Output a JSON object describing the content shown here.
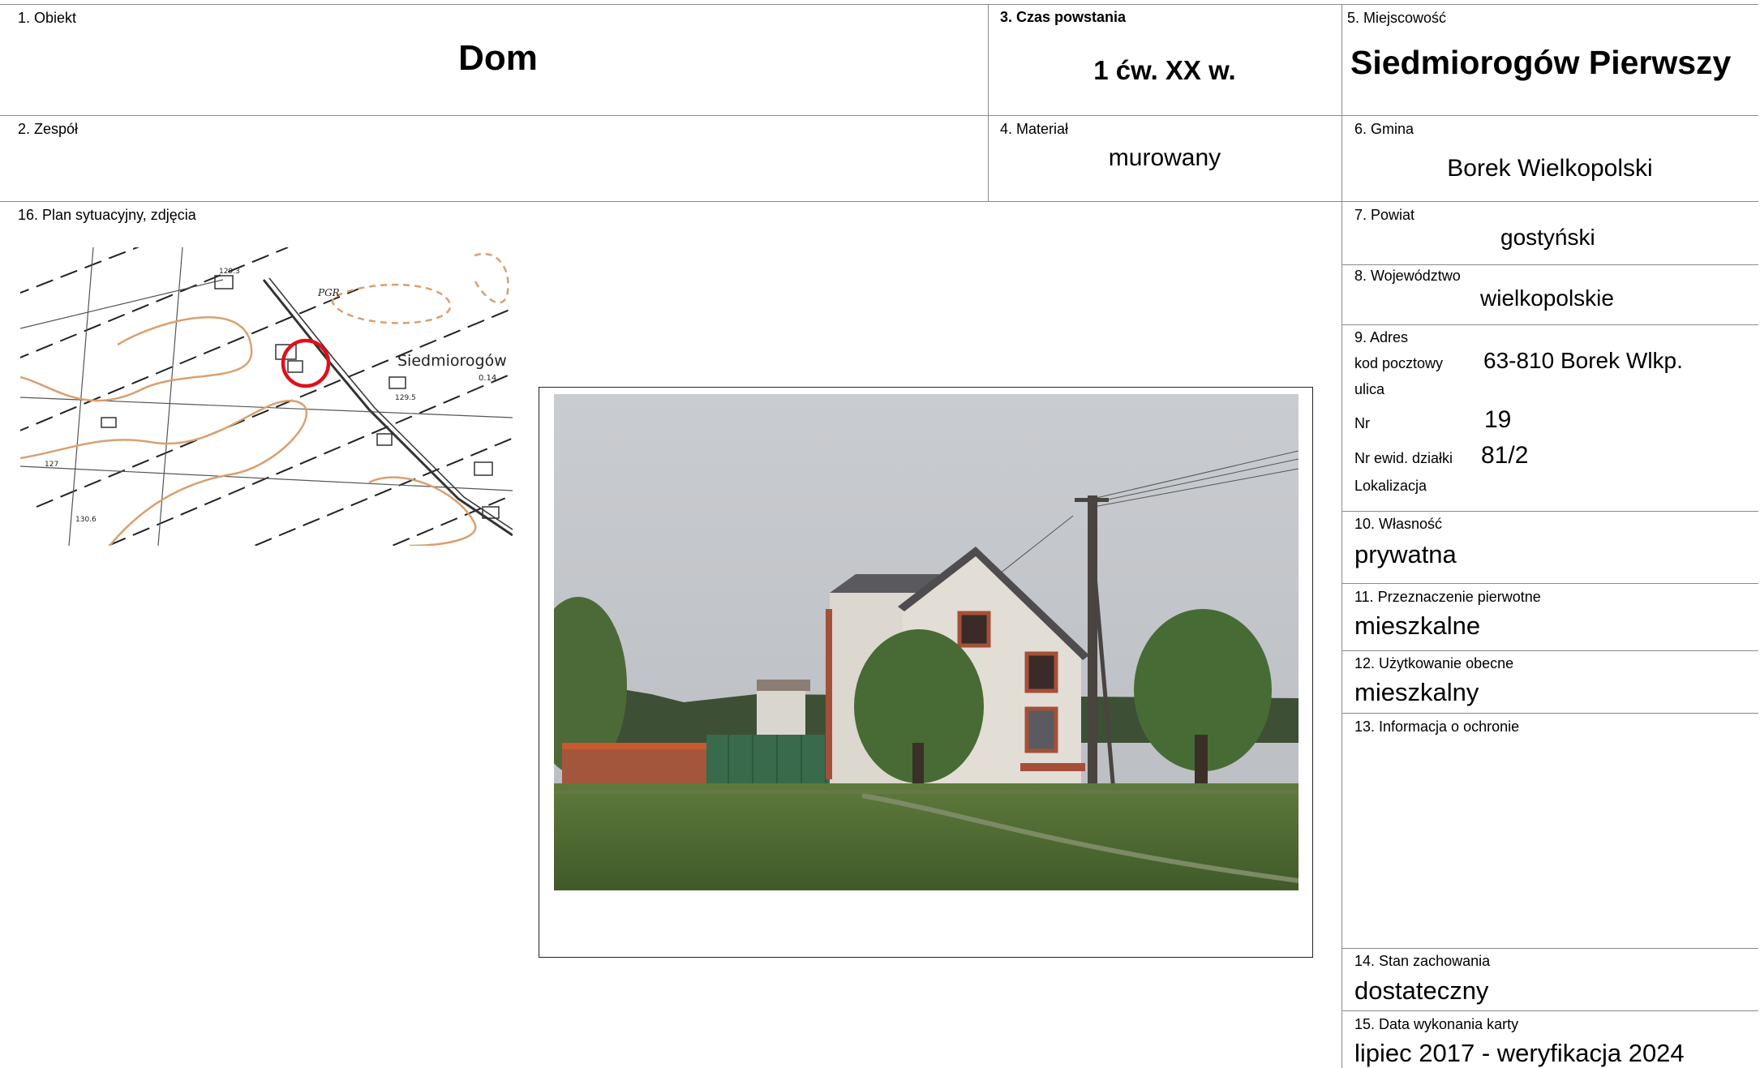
{
  "card": {
    "obiekt": {
      "label": "1. Obiekt",
      "value": "Dom"
    },
    "zespol": {
      "label": "2. Zespół",
      "value": ""
    },
    "czas": {
      "label": "3. Czas powstania",
      "value": "1 ćw. XX w."
    },
    "material": {
      "label": "4. Materiał",
      "value": "murowany"
    },
    "miejscowosc": {
      "label": "5. Miejscowość",
      "value": "Siedmiorogów Pierwszy"
    },
    "gmina": {
      "label": "6. Gmina",
      "value": "Borek Wielkopolski"
    },
    "powiat": {
      "label": "7. Powiat",
      "value": "gostyński"
    },
    "wojewodztwo": {
      "label": "8. Województwo",
      "value": "wielkopolskie"
    },
    "adres": {
      "label": "9. Adres",
      "kod_label": "kod pocztowy",
      "kod_value": "63-810 Borek Wlkp.",
      "ulica_label": "ulica",
      "nr_label": "Nr",
      "nr_value": "19",
      "dzialka_label": "Nr ewid. działki",
      "dzialka_value": "81/2",
      "lokalizacja_label": "Lokalizacja"
    },
    "wlasnosc": {
      "label": "10. Własność",
      "value": "prywatna"
    },
    "przeznaczenie": {
      "label": "11. Przeznaczenie pierwotne",
      "value": "mieszkalne"
    },
    "uzytkowanie": {
      "label": "12. Użytkowanie obecne",
      "value": "mieszkalny"
    },
    "ochrona": {
      "label": "13. Informacja o ochronie",
      "value": ""
    },
    "stan": {
      "label": "14. Stan zachowania",
      "value": "dostateczny"
    },
    "data": {
      "label": "15. Data wykonania karty",
      "value": "lipiec 2017 - weryfikacja 2024"
    },
    "plan": {
      "label": "16. Plan sytuacyjny, zdjęcia"
    }
  },
  "map": {
    "place_label": "Siedmiorogów",
    "small_label": "0.14",
    "pgr_label": "PGR",
    "heights": [
      "129.3",
      "129.5",
      "130.6",
      "127"
    ],
    "marker_color": "#e0101a",
    "contour_color": "#d9a070"
  }
}
